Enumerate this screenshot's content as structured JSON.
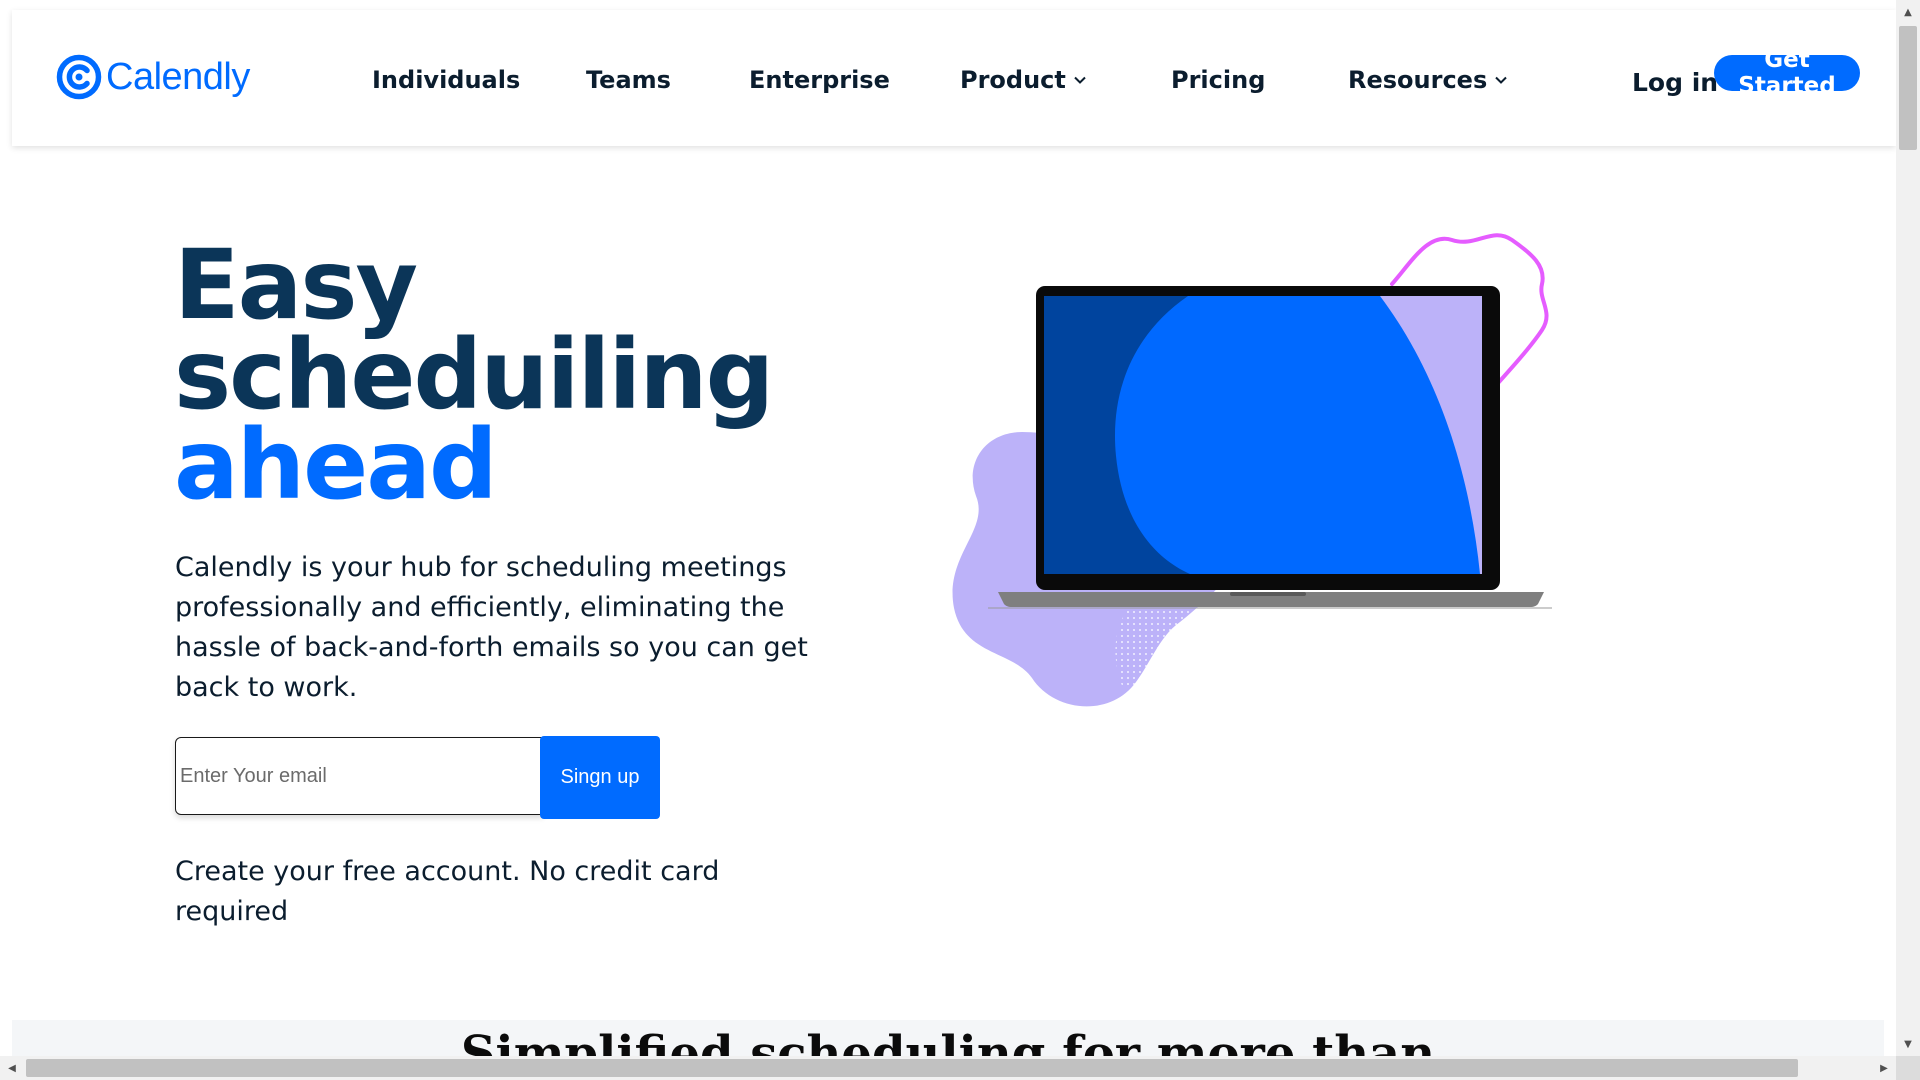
{
  "brand": {
    "name": "Calendly",
    "logo_icon": "calendly-logo-icon",
    "color": "#006bff"
  },
  "nav": {
    "items": [
      {
        "label": "Individuals",
        "has_dropdown": false
      },
      {
        "label": "Teams",
        "has_dropdown": false
      },
      {
        "label": "Enterprise",
        "has_dropdown": false
      },
      {
        "label": "Product",
        "has_dropdown": true,
        "icon": "chevron-down-icon"
      },
      {
        "label": "Pricing",
        "has_dropdown": false
      },
      {
        "label": "Resources",
        "has_dropdown": true,
        "icon": "chevron-down-icon"
      }
    ],
    "login_label": "Log in",
    "cta_label": "Get Started"
  },
  "hero": {
    "title_lines": [
      "Easy",
      "scheduiling",
      "ahead"
    ],
    "description": "Calendly is your hub for scheduling meetings professionally and efficiently, eliminating the hassle of back-and-forth emails so you can get back to work.",
    "email_placeholder": "Enter Your email",
    "email_value": "",
    "signup_label": "Singn up",
    "note": "Create your free account. No credit card required"
  },
  "section2": {
    "title": "Simplified scheduling for more than"
  },
  "colors": {
    "primary": "#006bff",
    "heading": "#0b3558",
    "lavender": "#bcb2f9",
    "pink_outline": "#e55cff",
    "screen_dark": "#00449e"
  }
}
